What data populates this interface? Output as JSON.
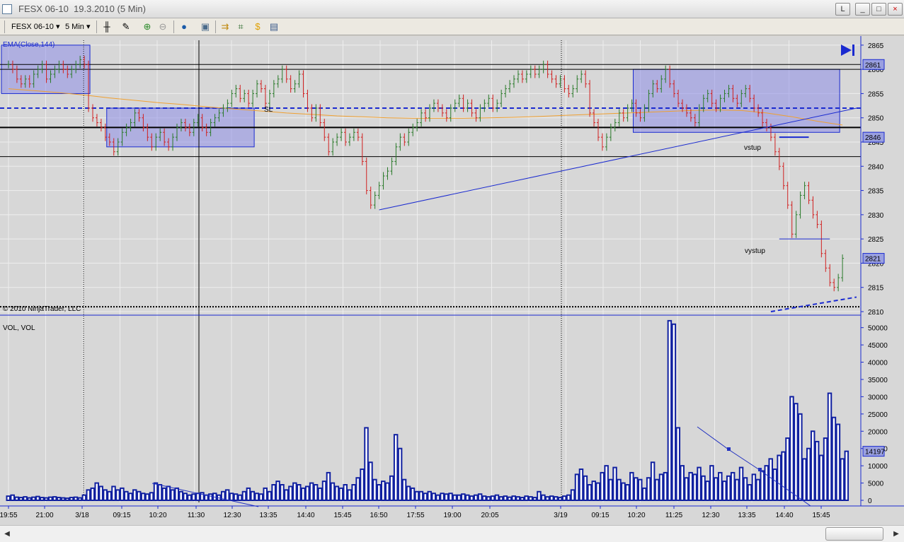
{
  "window": {
    "title": "FESX 06-10  19.3.2010 (5 Min)",
    "buttons": {
      "link": "L",
      "minimize": "_",
      "maximize": "□",
      "close": "×"
    }
  },
  "toolbar": {
    "instrument": "FESX 06-10",
    "interval": "5 Min",
    "icons": [
      "bar-type-icon",
      "draw-tool-icon",
      "zoom-in-icon",
      "zoom-out-icon",
      "globe-icon",
      "properties-icon",
      "strategy-icon",
      "indicator-icon",
      "money-icon",
      "data-box-icon"
    ]
  },
  "price_panel": {
    "indicator_label": "EMA(Close,144)",
    "copyright": "© 2010 NinjaTrader, LLC",
    "annotations": {
      "sl": "SL",
      "vstup": "vstup",
      "vystup": "vystup"
    },
    "price_markers": [
      "2861",
      "2846",
      "2821"
    ],
    "axis_ticks": [
      "2865",
      "2860",
      "2855",
      "2850",
      "2845",
      "2840",
      "2835",
      "2830",
      "2825",
      "2820",
      "2815",
      "2810"
    ]
  },
  "volume_panel": {
    "label": "VOL, VOL",
    "price_marker": "14197",
    "axis_ticks": [
      "50000",
      "45000",
      "40000",
      "35000",
      "30000",
      "25000",
      "20000",
      "15000",
      "10000",
      "5000",
      "0"
    ]
  },
  "time_axis": [
    "19:55",
    "21:00",
    "3/18",
    "09:15",
    "10:20",
    "11:30",
    "12:30",
    "13:35",
    "14:40",
    "15:45",
    "16:50",
    "17:55",
    "19:00",
    "20:05",
    "3/19",
    "09:15",
    "10:20",
    "11:25",
    "12:30",
    "13:35",
    "14:40",
    "15:45"
  ],
  "chart_data": {
    "type": "bar",
    "title": "FESX 06-10  19.3.2010 (5 Min)",
    "price_ylim": [
      2810,
      2866
    ],
    "volume_ylim": [
      0,
      53000
    ],
    "ema_name": "EMA(Close,144)",
    "closes": [
      2861,
      2860,
      2858,
      2857,
      2858,
      2857,
      2859,
      2860,
      2861,
      2858,
      2859,
      2860,
      2861,
      2860,
      2859,
      2860,
      2861,
      2862,
      2861,
      2852,
      2850,
      2849,
      2848,
      2846,
      2845,
      2843,
      2845,
      2847,
      2848,
      2849,
      2851,
      2850,
      2848,
      2846,
      2844,
      2846,
      2847,
      2845,
      2844,
      2846,
      2848,
      2849,
      2848,
      2847,
      2849,
      2850,
      2848,
      2847,
      2849,
      2850,
      2851,
      2852,
      2853,
      2855,
      2856,
      2854,
      2855,
      2853,
      2855,
      2857,
      2856,
      2853,
      2855,
      2857,
      2858,
      2860,
      2858,
      2856,
      2857,
      2859,
      2855,
      2852,
      2850,
      2852,
      2849,
      2846,
      2843,
      2845,
      2846,
      2847,
      2845,
      2846,
      2847,
      2846,
      2841,
      2835,
      2832,
      2834,
      2836,
      2838,
      2839,
      2841,
      2844,
      2846,
      2845,
      2847,
      2848,
      2849,
      2851,
      2850,
      2852,
      2853,
      2852,
      2851,
      2850,
      2852,
      2853,
      2854,
      2852,
      2853,
      2851,
      2850,
      2852,
      2853,
      2854,
      2852,
      2853,
      2855,
      2856,
      2857,
      2858,
      2859,
      2858,
      2859,
      2860,
      2859,
      2860,
      2861,
      2859,
      2858,
      2857,
      2858,
      2856,
      2855,
      2856,
      2858,
      2859,
      2857,
      2851,
      2849,
      2846,
      2844,
      2846,
      2848,
      2849,
      2851,
      2850,
      2852,
      2853,
      2851,
      2850,
      2852,
      2855,
      2857,
      2856,
      2858,
      2860,
      2857,
      2855,
      2853,
      2852,
      2851,
      2850,
      2849,
      2852,
      2854,
      2855,
      2853,
      2852,
      2854,
      2855,
      2856,
      2854,
      2853,
      2855,
      2856,
      2854,
      2852,
      2851,
      2849,
      2848,
      2846,
      2843,
      2840,
      2836,
      2832,
      2826,
      2830,
      2834,
      2836,
      2833,
      2830,
      2828,
      2822,
      2819,
      2816,
      2815,
      2817,
      2821
    ],
    "volumes": [
      1200,
      1500,
      900,
      800,
      1000,
      700,
      900,
      1100,
      800,
      700,
      900,
      1000,
      800,
      700,
      600,
      800,
      900,
      700,
      1500,
      3000,
      3500,
      5000,
      4000,
      3000,
      2500,
      4000,
      3000,
      3500,
      2500,
      2000,
      3000,
      2500,
      2000,
      1800,
      2200,
      5000,
      4500,
      3500,
      4000,
      3000,
      3500,
      2500,
      2000,
      1500,
      1800,
      2000,
      2200,
      1500,
      1800,
      2000,
      1500,
      2500,
      3000,
      2000,
      1800,
      1500,
      2500,
      3500,
      2500,
      2000,
      1800,
      3500,
      2500,
      4500,
      5500,
      4500,
      3000,
      4000,
      5000,
      4500,
      3500,
      4000,
      5000,
      4500,
      3500,
      5500,
      8000,
      5000,
      4000,
      3500,
      4500,
      3000,
      4500,
      6500,
      9000,
      21000,
      11000,
      6000,
      4500,
      5500,
      5000,
      7000,
      19000,
      15000,
      6000,
      4000,
      3500,
      2500,
      2500,
      2000,
      2500,
      2000,
      1500,
      2000,
      1800,
      2000,
      1500,
      1500,
      1800,
      1500,
      1200,
      1500,
      1800,
      1200,
      1000,
      1200,
      1500,
      1000,
      1200,
      900,
      1200,
      1000,
      800,
      1200,
      1000,
      800,
      2500,
      1500,
      1000,
      1200,
      1000,
      800,
      1200,
      1500,
      3000,
      7500,
      9000,
      7000,
      4500,
      5500,
      5000,
      8000,
      10000,
      6000,
      9500,
      6000,
      5000,
      4500,
      8000,
      6500,
      6000,
      3500,
      6500,
      11000,
      6000,
      7500,
      8000,
      52000,
      51000,
      21000,
      10000,
      6500,
      8000,
      7500,
      9500,
      7000,
      5500,
      10000,
      6500,
      8000,
      5500,
      7000,
      8000,
      6000,
      9500,
      6500,
      4500,
      7500,
      6000,
      8500,
      10000,
      12000,
      9000,
      13000,
      14000,
      18000,
      30000,
      28000,
      25000,
      12000,
      15000,
      20000,
      17000,
      13000,
      18000,
      31000,
      24000,
      22000,
      12000,
      14197
    ],
    "ema": [
      2856,
      2855.6,
      2855.2,
      2854.7,
      2854.1,
      2853.6,
      2853.1,
      2852.7,
      2852.2,
      2851.8,
      2851.4,
      2851.0,
      2850.7,
      2850.4,
      2850.2,
      2850.0,
      2849.9,
      2849.9,
      2849.9,
      2850.0,
      2850.1,
      2850.3,
      2850.5,
      2850.7,
      2850.9,
      2851.1,
      2851.3,
      2851.5,
      2851.6,
      2851.5,
      2851.0,
      2850.2,
      2849.3,
      2848.5
    ],
    "horizontal_lines": {
      "black": [
        2861,
        2860,
        2848,
        2842
      ],
      "blue_dashed": 2852,
      "dotted": 2811
    },
    "shaded_zones": [
      {
        "from_bar": 0,
        "to_bar": 19,
        "low": 2855,
        "high": 2865
      },
      {
        "from_bar": 25,
        "to_bar": 58,
        "low": 2844,
        "high": 2852
      },
      {
        "from_bar": 150,
        "to_bar": 197,
        "low": 2847,
        "high": 2860
      }
    ],
    "trendlines": [
      {
        "from": [
          88,
          2831
        ],
        "to": [
          201,
          2852
        ],
        "style": "solid"
      },
      {
        "from": [
          181,
          2810
        ],
        "to": [
          201,
          2813
        ],
        "style": "dashed"
      }
    ],
    "entry_exit_marks": [
      {
        "label": "vstup",
        "bar_from": 184,
        "bar_to": 190,
        "price": 2846
      },
      {
        "label": "vystup",
        "bar_from": 184,
        "bar_to": 195,
        "price": 2825
      }
    ]
  }
}
